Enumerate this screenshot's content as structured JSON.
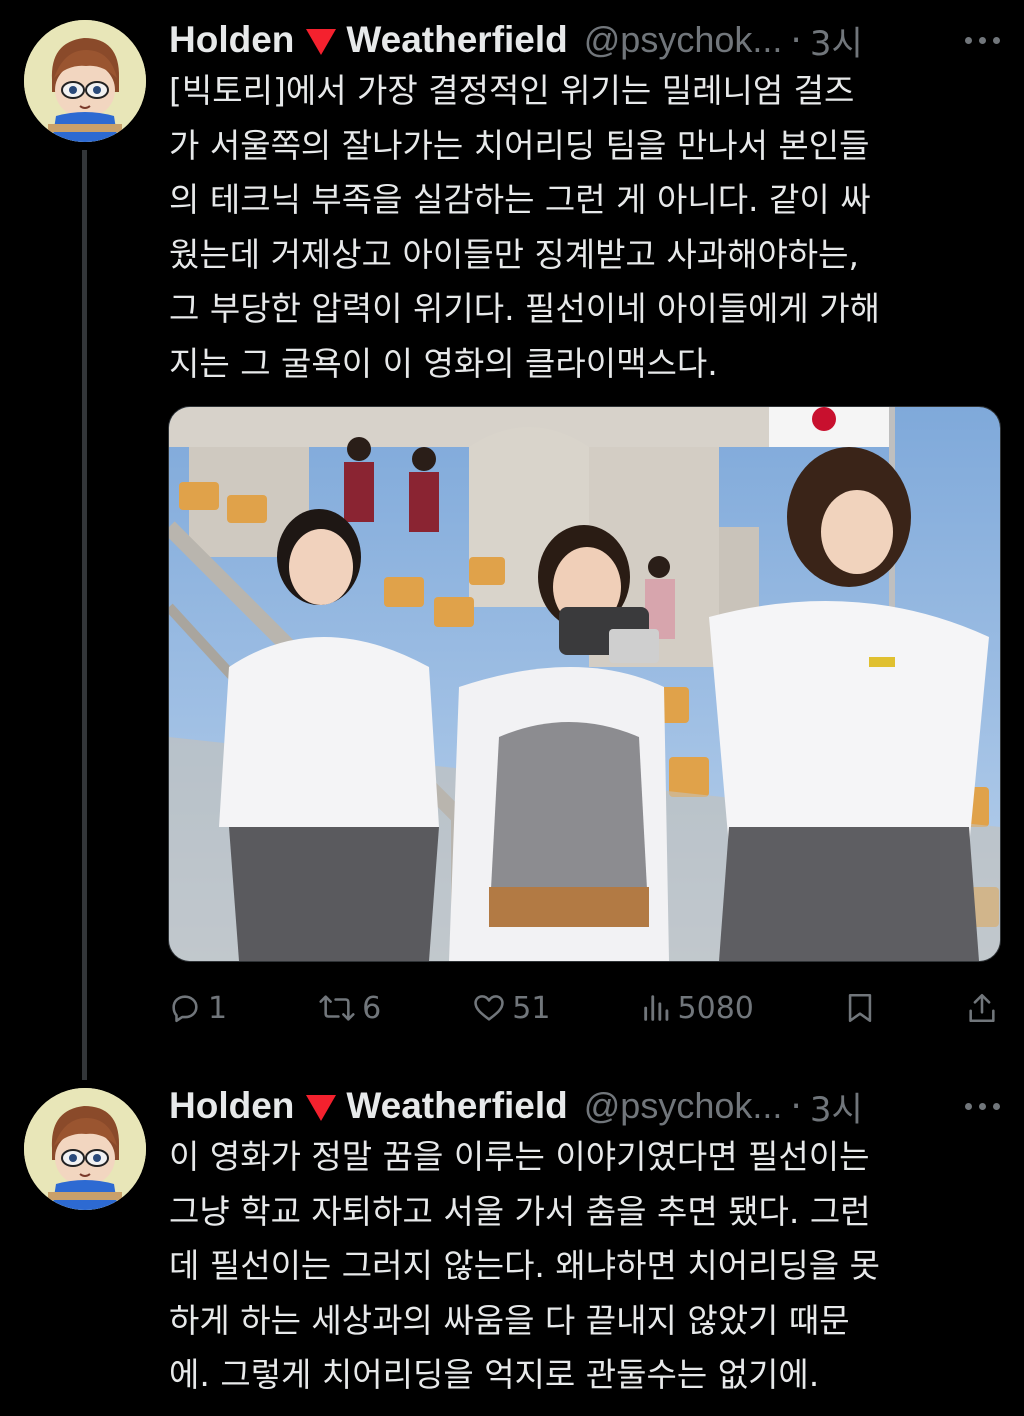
{
  "tweets": [
    {
      "author_name": "Holden",
      "author_name_suffix": "Weatherfield",
      "author_handle": "@psychok...",
      "separator": "·",
      "time": "3시",
      "text": "[빅토리]에서 가장 결정적인 위기는 밀레니엄 걸즈\n가 서울쪽의 잘나가는 치어리딩 팀을 만나서 본인들\n의 테크닉 부족을 실감하는 그런 게 아니다. 같이 싸\n웠는데 거제상고 아이들만 징계받고 사과해야하는,\n그 부당한 압력이 위기다. 필선이네 아이들에게 가해\n지는 그 굴욕이 이 영화의 클라이맥스다.",
      "actions": {
        "replies": "1",
        "retweets": "6",
        "likes": "51",
        "views": "5080"
      },
      "icons": {
        "flag": "red-triangle-icon",
        "reply": "reply-icon",
        "retweet": "retweet-icon",
        "like": "heart-icon",
        "views": "views-icon",
        "bookmark": "bookmark-icon",
        "share": "share-icon"
      }
    },
    {
      "author_name": "Holden",
      "author_name_suffix": "Weatherfield",
      "author_handle": "@psychok...",
      "separator": "·",
      "time": "3시",
      "text": "이 영화가 정말 꿈을 이루는 이야기였다면 필선이는\n그냥 학교 자퇴하고 서울 가서 춤을 추면 됐다. 그런\n데 필선이는 그러지 않는다. 왜냐하면 치어리딩을 못\n하게 하는 세상과의 싸움을 다 끝내지 않았기 때문\n에. 그렇게 치어리딩을 억지로 관둘수는 없기에."
    }
  ],
  "colors": {
    "background": "#000000",
    "text": "#e7e9ea",
    "secondary": "#71767b",
    "flag": "#f4212e"
  }
}
